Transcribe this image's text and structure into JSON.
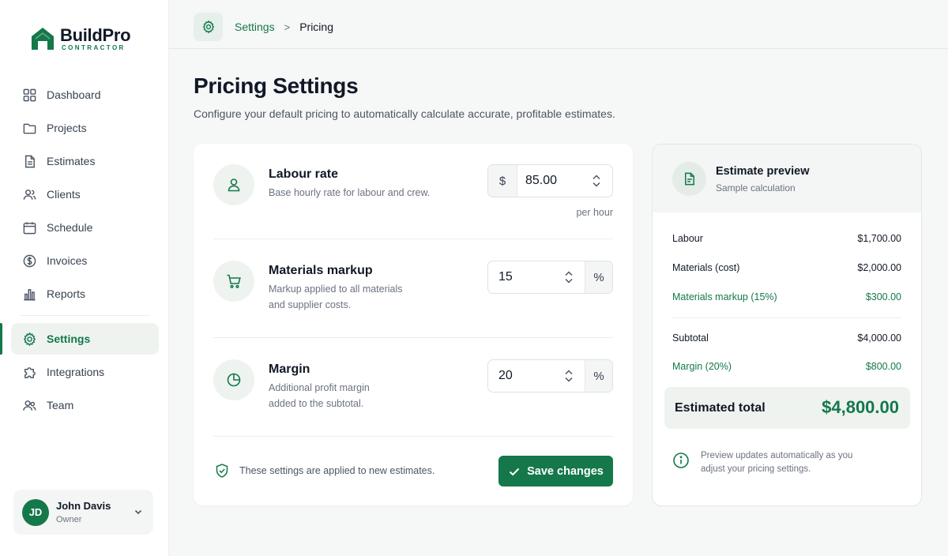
{
  "brand": {
    "name": "BuildPro",
    "tagline": "CONTRACTOR",
    "accent": "#14784a"
  },
  "sidebar": {
    "items": [
      {
        "label": "Dashboard",
        "icon": "grid-icon"
      },
      {
        "label": "Projects",
        "icon": "folder-icon"
      },
      {
        "label": "Estimates",
        "icon": "file-icon"
      },
      {
        "label": "Clients",
        "icon": "users-icon"
      },
      {
        "label": "Schedule",
        "icon": "calendar-icon"
      },
      {
        "label": "Invoices",
        "icon": "dollar-circle-icon"
      },
      {
        "label": "Reports",
        "icon": "bar-chart-icon"
      },
      {
        "label": "Settings",
        "icon": "gear-icon",
        "active": true
      },
      {
        "label": "Integrations",
        "icon": "puzzle-icon"
      },
      {
        "label": "Team",
        "icon": "team-icon"
      }
    ]
  },
  "user": {
    "initials": "JD",
    "name": "John Davis",
    "role": "Owner"
  },
  "breadcrumb": {
    "parent": "Settings",
    "separator": ">",
    "current": "Pricing"
  },
  "page": {
    "title": "Pricing Settings",
    "subtitle": "Configure your default pricing to automatically calculate accurate, profitable estimates."
  },
  "pricing": {
    "labour": {
      "title": "Labour rate",
      "desc": "Base hourly rate for labour and crew.",
      "prefix": "$",
      "value": "85.00",
      "unit": "per hour"
    },
    "markup": {
      "title": "Materials markup",
      "desc_line1": "Markup applied to all materials",
      "desc_line2": "and supplier costs.",
      "value": "15",
      "suffix": "%"
    },
    "margin": {
      "title": "Margin",
      "desc_line1": "Additional profit margin",
      "desc_line2": "added to the subtotal.",
      "value": "20",
      "suffix": "%"
    },
    "footer_note": "These settings are applied to new estimates.",
    "save_label": "Save changes"
  },
  "preview": {
    "title": "Estimate preview",
    "subtitle": "Sample calculation",
    "lines": [
      {
        "label": "Labour",
        "value": "$1,700.00"
      },
      {
        "label": "Materials (cost)",
        "value": "$2,000.00"
      },
      {
        "label": "Materials markup (15%)",
        "value": "$300.00"
      },
      {
        "label": "Subtotal",
        "value": "$4,000.00"
      },
      {
        "label": "Margin (20%)",
        "value": "$800.00"
      }
    ],
    "total_label": "Estimated total",
    "total_value": "$4,800.00",
    "info_line1": "Preview updates automatically as you",
    "info_line2": "adjust your pricing settings."
  }
}
